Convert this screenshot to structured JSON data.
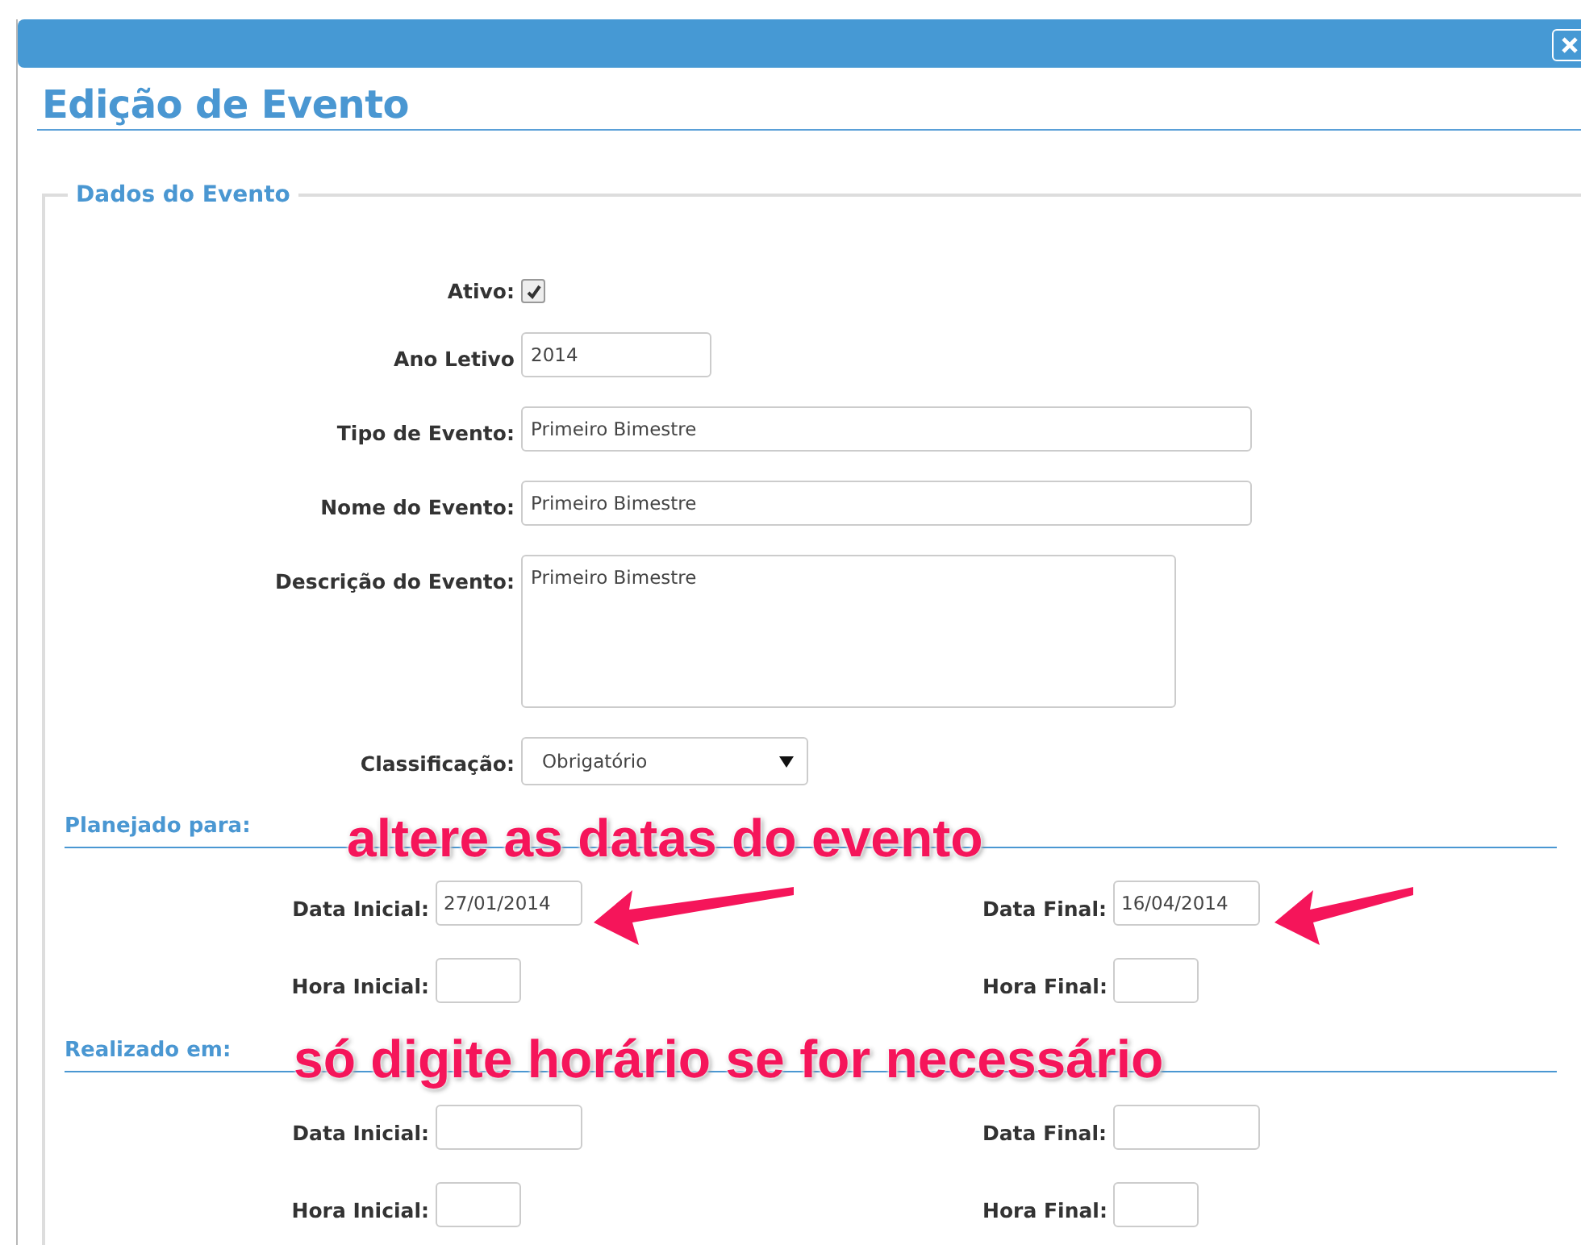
{
  "dialog": {
    "title": "Edição de Evento"
  },
  "fieldset": {
    "legend": "Dados do Evento",
    "fields": [
      {
        "kind": "checkbox",
        "label": "Ativo:",
        "checked": true
      },
      {
        "kind": "short",
        "label": "Ano Letivo",
        "value": "2014"
      },
      {
        "kind": "text",
        "label": "Tipo de Evento:",
        "value": "Primeiro Bimestre"
      },
      {
        "kind": "text",
        "label": "Nome do Evento:",
        "value": "Primeiro Bimestre"
      },
      {
        "kind": "textarea",
        "label": "Descrição do Evento:",
        "value": "Primeiro Bimestre"
      },
      {
        "kind": "select",
        "label": "Classificação:",
        "value": "Obrigatório"
      }
    ]
  },
  "sections": [
    {
      "title": "Planejado para:",
      "rows": [
        [
          {
            "kind": "date",
            "label": "Data Inicial:",
            "value": "27/01/2014"
          },
          {
            "kind": "date",
            "label": "Data Final:",
            "value": "16/04/2014"
          }
        ],
        [
          {
            "kind": "time",
            "label": "Hora Inicial:"
          },
          {
            "kind": "time",
            "label": "Hora Final:"
          }
        ]
      ]
    },
    {
      "title": "Realizado em:",
      "rows": [
        [
          {
            "kind": "date",
            "label": "Data Inicial:"
          },
          {
            "kind": "date",
            "label": "Data Final:"
          }
        ],
        [
          {
            "kind": "time",
            "label": "Hora Inicial:"
          },
          {
            "kind": "time",
            "label": "Hora Final:"
          }
        ]
      ]
    }
  ],
  "annotations": [
    {
      "text": "altere as datas do evento"
    },
    {
      "text": "só digite horário se for necessário"
    }
  ]
}
